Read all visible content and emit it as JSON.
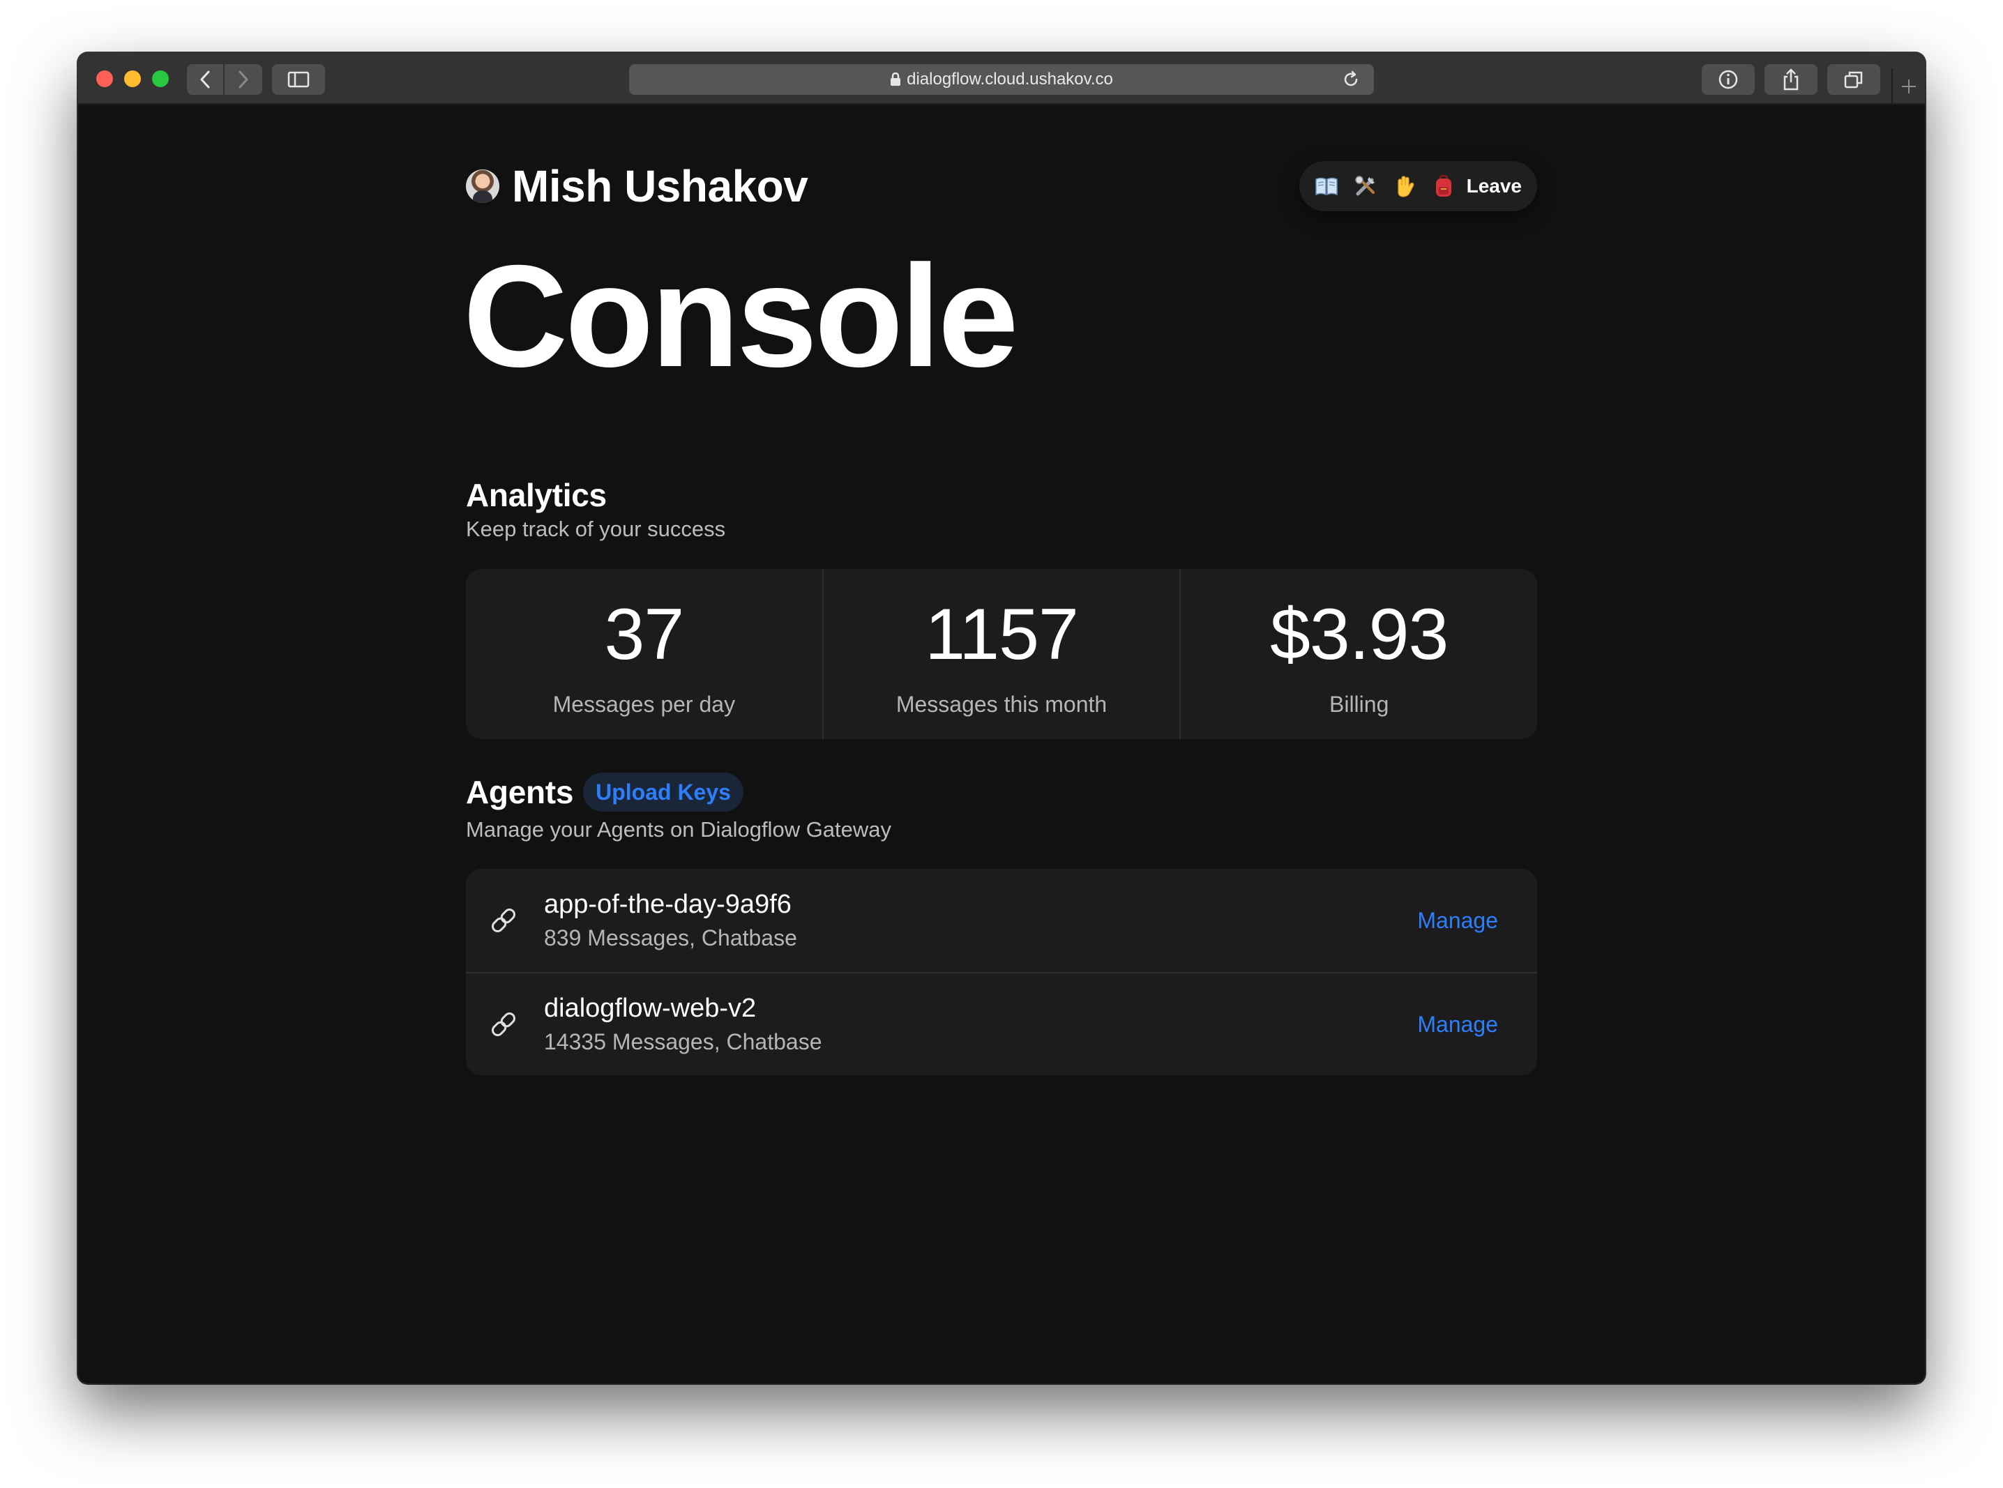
{
  "browser": {
    "url": "dialogflow.cloud.ushakov.co"
  },
  "header": {
    "name": "Mish Ushakov",
    "menu": {
      "icons": [
        "book-icon",
        "tools-icon",
        "waving-hand-icon",
        "backpack-icon"
      ],
      "leave_label": "Leave"
    }
  },
  "page": {
    "title": "Console"
  },
  "analytics": {
    "title": "Analytics",
    "subtitle": "Keep track of your success",
    "stats": [
      {
        "value": "37",
        "label": "Messages per day"
      },
      {
        "value": "1157",
        "label": "Messages this month"
      },
      {
        "value": "$3.93",
        "label": "Billing"
      }
    ]
  },
  "agents": {
    "title": "Agents",
    "upload_label": "Upload Keys",
    "subtitle": "Manage your Agents on Dialogflow Gateway",
    "items": [
      {
        "name": "app-of-the-day-9a9f6",
        "meta": "839 Messages, Chatbase",
        "action": "Manage"
      },
      {
        "name": "dialogflow-web-v2",
        "meta": "14335 Messages, Chatbase",
        "action": "Manage"
      }
    ]
  },
  "colors": {
    "background": "#111111",
    "card": "#1c1c1e",
    "accent": "#2d7ff9",
    "muted_text": "#b6b6b8"
  }
}
